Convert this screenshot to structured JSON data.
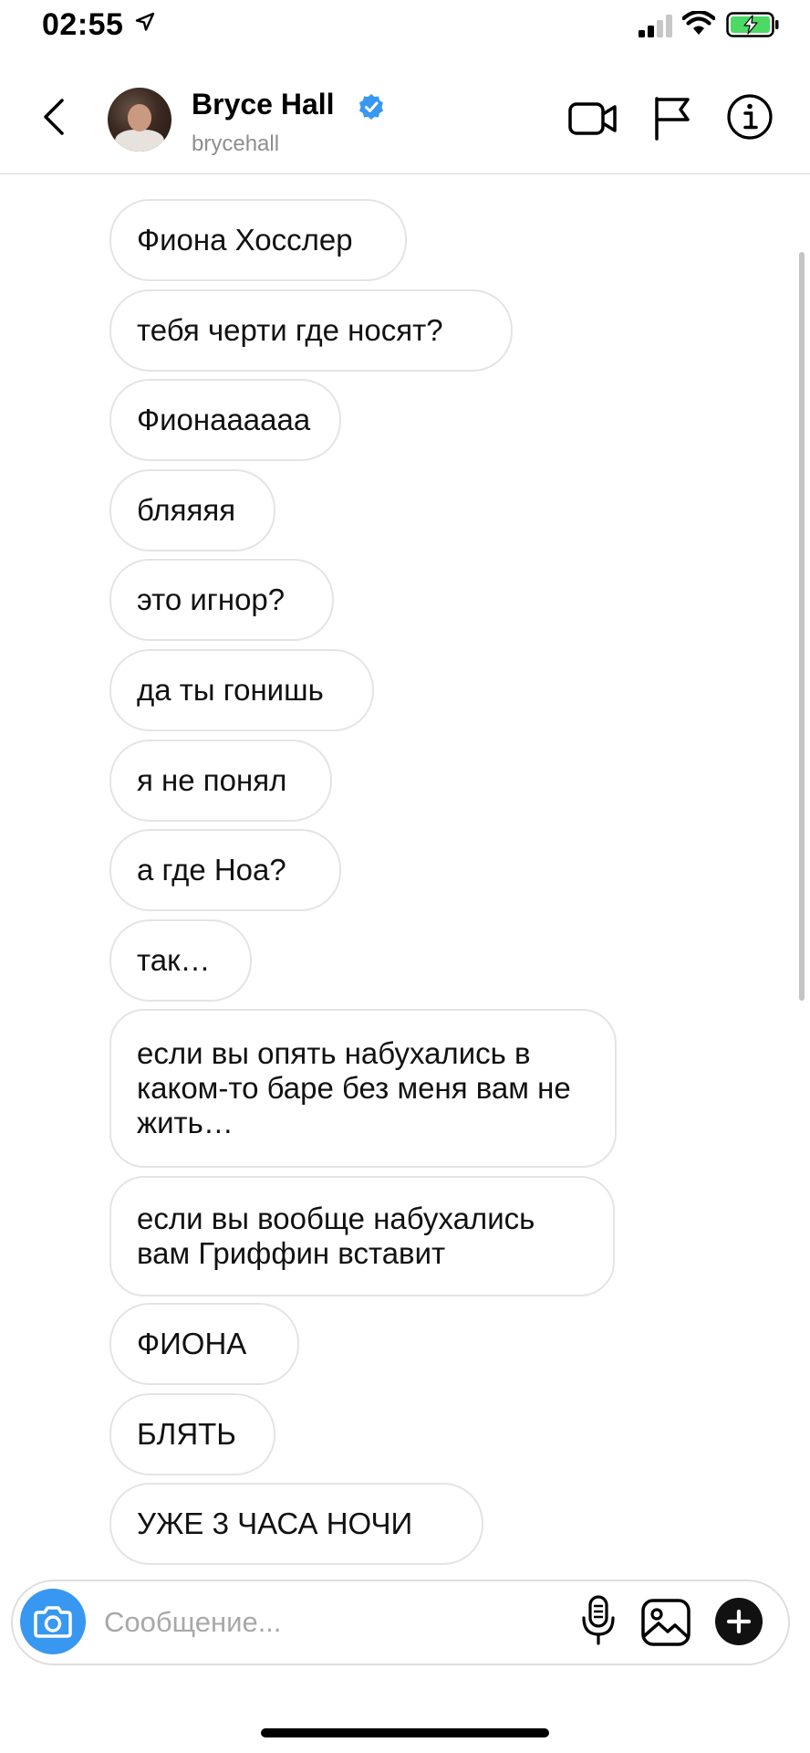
{
  "status_bar": {
    "time": "02:55",
    "icons": [
      "location-arrow-icon",
      "cellular-signal-icon",
      "wifi-icon",
      "battery-charging-icon"
    ],
    "battery_color": "#4cd964"
  },
  "header": {
    "name": "Bryce Hall",
    "username": "brycehall",
    "verified_color": "#3897f0",
    "icons": [
      "back-chevron-icon",
      "verified-badge-icon",
      "video-call-icon",
      "flag-icon",
      "info-icon"
    ]
  },
  "messages": [
    {
      "text": "Фиона Хосслер"
    },
    {
      "text": "тебя черти где носят?"
    },
    {
      "text": "Фионаааааа"
    },
    {
      "text": "бляяяя"
    },
    {
      "text": "это игнор?"
    },
    {
      "text": "да ты гонишь"
    },
    {
      "text": "я не понял"
    },
    {
      "text": "а где Ноа?"
    },
    {
      "text": "так…"
    },
    {
      "text": "если вы опять набухались в каком-то баре без меня вам не жить…"
    },
    {
      "text": "если вы вообще набухались вам Гриффин вставит"
    },
    {
      "text": "ФИОНА"
    },
    {
      "text": "БЛЯТЬ"
    },
    {
      "text": "УЖЕ 3 ЧАСА НОЧИ"
    }
  ],
  "composer": {
    "placeholder": "Сообщение...",
    "value": "",
    "accent": "#3897f0",
    "icons": [
      "camera-icon",
      "microphone-icon",
      "gallery-icon",
      "plus-icon"
    ]
  }
}
